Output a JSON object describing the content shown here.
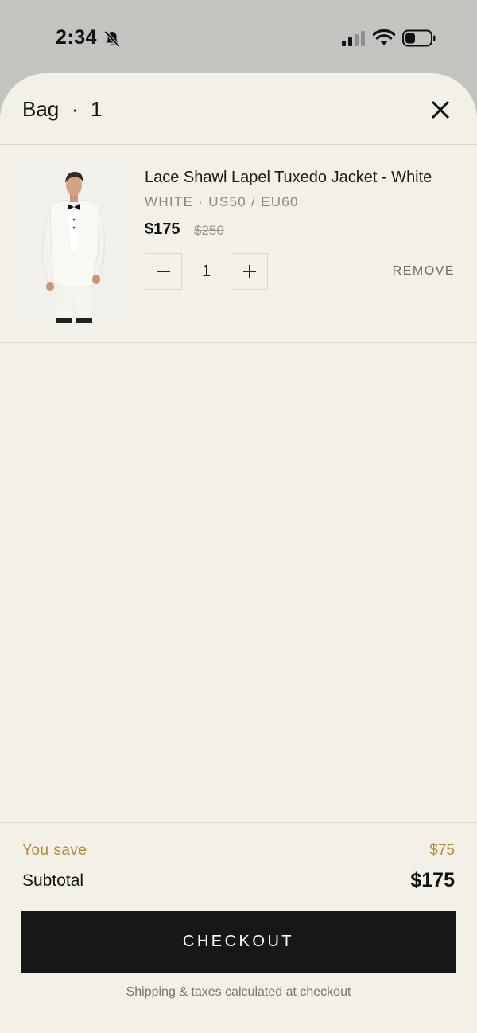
{
  "status_bar": {
    "time": "2:34",
    "icons": [
      "bell-slash-icon",
      "signal-icon",
      "wifi-icon",
      "battery-icon"
    ]
  },
  "header": {
    "title": "Bag",
    "separator": "·",
    "count": "1",
    "close_icon": "close-icon"
  },
  "cart": {
    "items": [
      {
        "name": "Lace Shawl Lapel Tuxedo Jacket - White",
        "variant": "WHITE  ·  US50 / EU60",
        "price": "$175",
        "original_price": "$250",
        "quantity": "1",
        "remove_label": "REMOVE",
        "image": "white-tuxedo-model-photo"
      }
    ]
  },
  "summary": {
    "save_label": "You save",
    "save_value": "$75",
    "subtotal_label": "Subtotal",
    "subtotal_value": "$175",
    "checkout_label": "CHECKOUT",
    "shipping_note": "Shipping & taxes calculated at checkout"
  },
  "colors": {
    "background": "#f3f0e8",
    "accent_gold": "#b48a35",
    "checkout_button": "#171717"
  }
}
